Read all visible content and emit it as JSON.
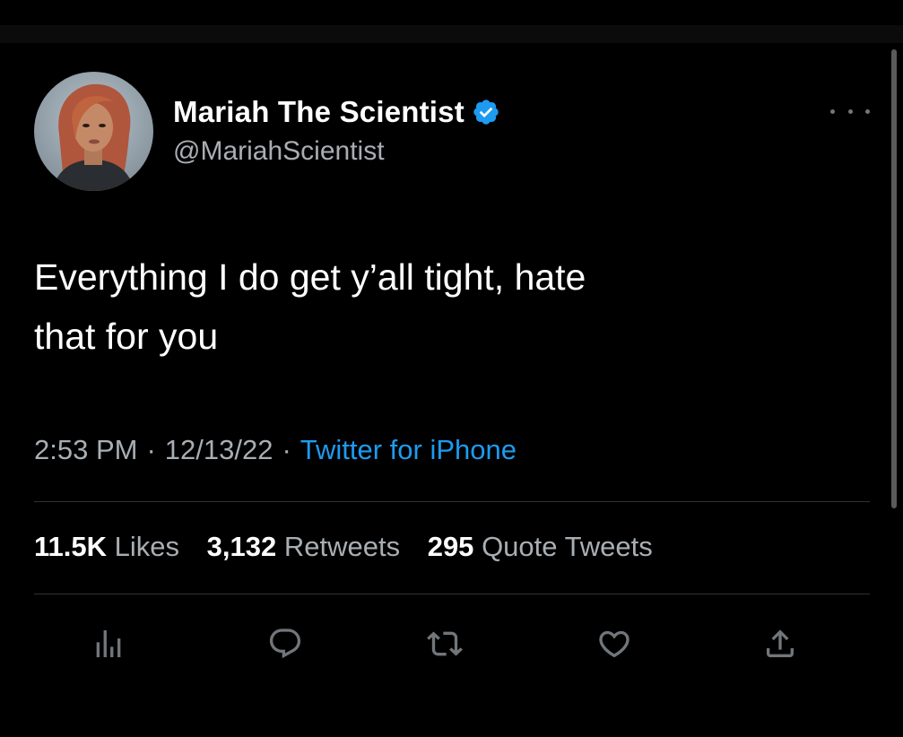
{
  "tweet": {
    "author": {
      "display_name": "Mariah The Scientist",
      "handle": "@MariahScientist",
      "verified": true
    },
    "text": "Everything I do get y’all tight, hate\nthat for you",
    "time": "2:53 PM",
    "date": "12/13/22",
    "source": "Twitter for iPhone",
    "separator": "·",
    "stats": {
      "likes_count": "11.5K",
      "likes_label": "Likes",
      "retweets_count": "3,132",
      "retweets_label": "Retweets",
      "quotes_count": "295",
      "quotes_label": "Quote Tweets"
    }
  },
  "actions": [
    "analytics-icon",
    "reply-icon",
    "retweet-icon",
    "like-icon",
    "share-icon"
  ],
  "colors": {
    "background": "#000000",
    "text_primary": "#ffffff",
    "text_secondary": "#a9aeb3",
    "accent": "#1d9bf0",
    "divider": "#2f3336"
  }
}
